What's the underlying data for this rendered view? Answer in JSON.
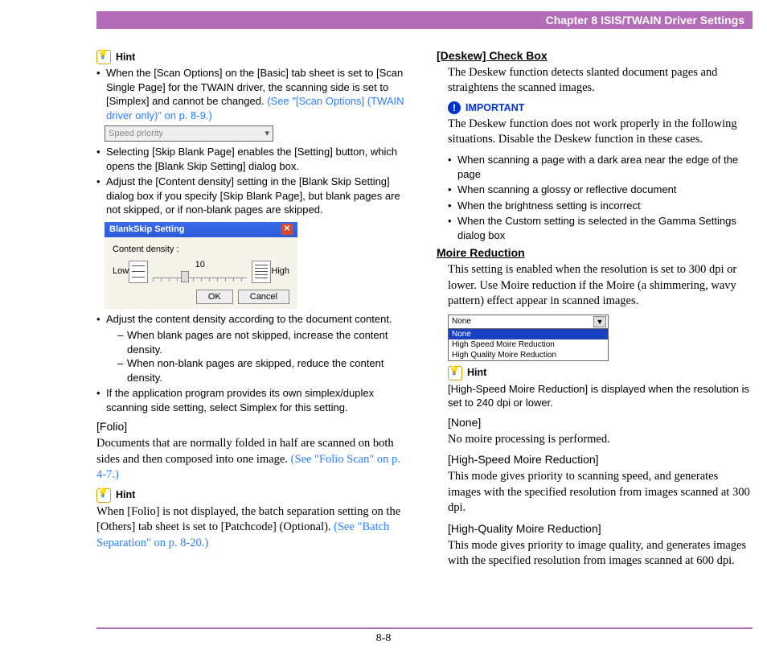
{
  "header": {
    "title": "Chapter 8   ISIS/TWAIN Driver Settings"
  },
  "footer": {
    "page": "8-8"
  },
  "labels": {
    "hint": "Hint",
    "important": "IMPORTANT"
  },
  "left": {
    "bullets1_a": "When the [Scan Options] on the [Basic] tab sheet is set to [Scan Single Page] for the TWAIN driver, the scanning side is set to [Simplex] and cannot be changed. ",
    "bullets1_a_link": "(See \"[Scan Options] (TWAIN driver only)\" on p. 8-9.)",
    "dropdown_value": "Speed priority",
    "bullets1_b": "Selecting [Skip Blank Page] enables the [Setting] button, which opens the [Blank Skip Setting] dialog box.",
    "bullets1_c": "Adjust the [Content density] setting in the [Blank Skip Setting] dialog box if you specify [Skip Blank Page], but blank pages are not skipped, or if non-blank pages are skipped.",
    "dlg": {
      "title": "BlankSkip Setting",
      "label_density": "Content density :",
      "low": "Low",
      "high": "High",
      "value": "10",
      "ok": "OK",
      "cancel": "Cancel"
    },
    "bullets2_a": "Adjust the content density according to the document content.",
    "bullets2_a_sub1": "When blank pages are not skipped, increase the content density.",
    "bullets2_a_sub2": "When non-blank pages are skipped, reduce the content density.",
    "bullets2_b": "If the application program provides its own simplex/duplex scanning side setting, select Simplex for this setting.",
    "folio_h": "[Folio]",
    "folio_text": "Documents that are normally folded in half are scanned on both sides and then composed into one image. ",
    "folio_link": "(See \"Folio Scan\" on p. 4-7.)",
    "hint2_text": "When [Folio] is not displayed, the batch separation setting on the [Others] tab sheet is set to [Patchcode] (Optional). ",
    "hint2_link": "(See \"Batch Separation\" on p. 8-20.)"
  },
  "right": {
    "deskew_h": "[Deskew] Check Box",
    "deskew_text": "The Deskew function detects slanted document pages and straightens the scanned images.",
    "imp_text": "The Deskew function does not work properly in the following situations. Disable the Deskew function in these cases.",
    "imp_b1": "When scanning a page with a dark area near the edge of the page",
    "imp_b2": "When scanning a glossy or reflective document",
    "imp_b3": "When the brightness setting is incorrect",
    "imp_b4": "When the Custom setting is selected in the Gamma Settings dialog box",
    "moire_h": "Moire Reduction",
    "moire_text": "This setting is enabled when the resolution is set to 300 dpi or lower. Use Moire reduction if the Moire (a shimmering, wavy pattern) effect appear in scanned images.",
    "moire_list": {
      "selected_top": "None",
      "opt0": "None",
      "opt1": "High Speed Moire Reduction",
      "opt2": "High Quality Moire Reduction"
    },
    "moire_hint": "[High-Speed Moire Reduction] is displayed when the resolution is set to 240 dpi or lower.",
    "none_h": "[None]",
    "none_text": "No moire processing is performed.",
    "hs_h": "[High-Speed Moire Reduction]",
    "hs_text": "This mode gives priority to scanning speed, and generates images with the specified resolution from images scanned at 300 dpi.",
    "hq_h": "[High-Quality Moire Reduction]",
    "hq_text": "This mode gives priority to image quality, and generates images with the specified resolution from images scanned at 600 dpi."
  }
}
